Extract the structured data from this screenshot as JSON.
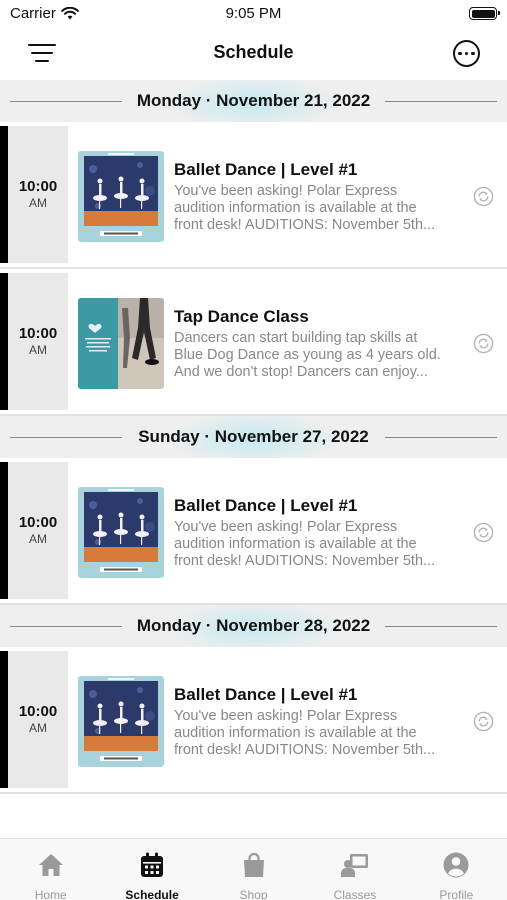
{
  "status_bar": {
    "carrier": "Carrier",
    "time": "9:05 PM"
  },
  "nav": {
    "title": "Schedule"
  },
  "schedule": [
    {
      "date": "Monday · November 21, 2022",
      "events": [
        {
          "time": "10:00",
          "ampm": "AM",
          "title": "Ballet Dance | Level #1",
          "desc": [
            "You've been asking! Polar Express",
            "audition information is available at the",
            "front desk! AUDITIONS: November 5th..."
          ],
          "thumb": "ballet"
        },
        {
          "time": "10:00",
          "ampm": "AM",
          "title": "Tap Dance Class",
          "desc": [
            "Dancers can start building tap skills at",
            "Blue Dog Dance as young as 4 years old.",
            "And we don't stop! Dancers can enjoy..."
          ],
          "thumb": "tap"
        }
      ]
    },
    {
      "date": "Sunday · November 27, 2022",
      "events": [
        {
          "time": "10:00",
          "ampm": "AM",
          "title": "Ballet Dance | Level #1",
          "desc": [
            "You've been asking! Polar Express",
            "audition information is available at the",
            "front desk! AUDITIONS: November 5th..."
          ],
          "thumb": "ballet"
        }
      ]
    },
    {
      "date": "Monday · November 28, 2022",
      "events": [
        {
          "time": "10:00",
          "ampm": "AM",
          "title": "Ballet Dance | Level #1",
          "desc": [
            "You've been asking! Polar Express",
            "audition information is available at the",
            "front desk! AUDITIONS: November 5th..."
          ],
          "thumb": "ballet"
        }
      ]
    }
  ],
  "tabs": [
    {
      "label": "Home",
      "icon": "home-icon",
      "active": false
    },
    {
      "label": "Schedule",
      "icon": "calendar-icon",
      "active": true
    },
    {
      "label": "Shop",
      "icon": "shopping-bag-icon",
      "active": false
    },
    {
      "label": "Classes",
      "icon": "classes-icon",
      "active": false
    },
    {
      "label": "Profile",
      "icon": "profile-icon",
      "active": false
    }
  ],
  "colors": {
    "accent": "#111111",
    "inactive": "#9a9a9a",
    "header_bg": "#efefef",
    "time_bg": "#e9e9e9",
    "desc": "#888888"
  }
}
